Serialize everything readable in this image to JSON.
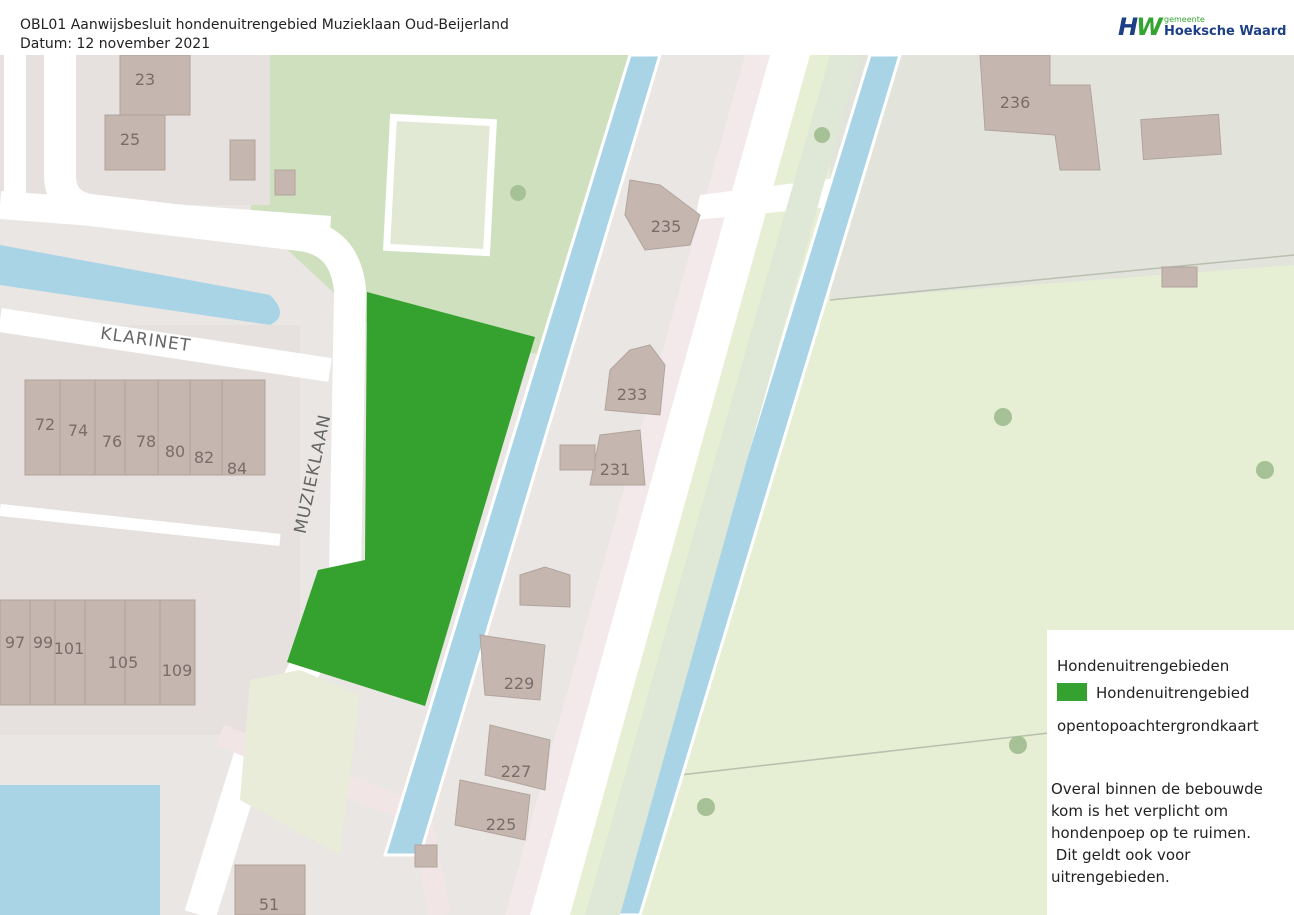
{
  "header": {
    "title": "OBL01 Aanwijsbesluit hondenuitrengebied Muzieklaan Oud-Beijerland",
    "date": "Datum: 12 november 2021"
  },
  "logo": {
    "mark_left": "H",
    "mark_right": "W",
    "small_text": "gemeente",
    "name": "Hoeksche Waard"
  },
  "colors": {
    "dog_area": "#35a22f",
    "brand_blue": "#1d3f86",
    "brand_green": "#35a532",
    "water": "#a9d4e6",
    "meadow": "#e6eed4",
    "building": "#c6b6b0",
    "road": "#ffffff"
  },
  "map": {
    "street_labels": [
      "KLARINET",
      "MUZIEKLAAN"
    ],
    "house_numbers": [
      "23",
      "25",
      "235",
      "236",
      "233",
      "231",
      "229",
      "227",
      "225",
      "72",
      "74",
      "76",
      "78",
      "80",
      "82",
      "84",
      "97",
      "99",
      "101",
      "105",
      "109",
      "51"
    ]
  },
  "legend": {
    "heading": "Hondenuitrengebieden",
    "item_label": "Hondenuitrengebied",
    "basemap_label": "opentopoachtergrondkaart",
    "note_lines": [
      "Overal binnen de bebouwde",
      "kom is het verplicht om",
      "hondenpoep op te ruimen.",
      " Dit geldt ook voor",
      "uitrengebieden."
    ]
  }
}
